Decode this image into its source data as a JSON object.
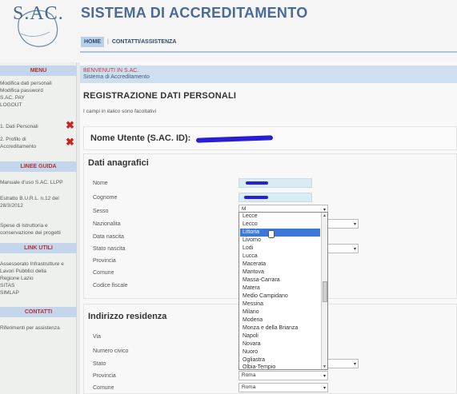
{
  "header": {
    "logo_text": "S.AC.",
    "title": "SISTEMA DI ACCREDITAMENTO",
    "nav": {
      "home": "HOME",
      "separator": "|",
      "contact": "CONTATTI/ASSISTENZA"
    }
  },
  "sidebar": {
    "menu_head": "MENU",
    "menu_items": [
      "Modifica dati personali",
      "Modifica password",
      "S.AC. PAY",
      "LOGOUT"
    ],
    "steps": [
      "1. Dati Personali",
      "2. Profilo di",
      "Accreditamento"
    ],
    "guide_head": "LINEE GUIDA",
    "guide_items": [
      "Manuale d'uso S.AC. LLPP",
      "Estratto B.U.R.L. n.12 del",
      "28/3/2012",
      "Spese di Istruttoria e",
      "conservazione dei progetti"
    ],
    "links_head": "LINK UTILI",
    "links_items": [
      "Assessorato Infrastrutture e",
      "Lavori Pubblici della",
      "Regione Lazio",
      "SITAS",
      "SIMLAP"
    ],
    "contacts_head": "CONTATTI",
    "contacts_items": [
      "Riferimenti per assistenza"
    ]
  },
  "main": {
    "welcome": "BENVENUTI IN S.AC.",
    "welcome_sub": "Sistema di Accreditamento",
    "page_title": "REGISTRAZIONE DATI PERSONALI",
    "hint_prefix": "I campi in",
    "hint_italic": "italico",
    "hint_suffix": "sono facoltativi",
    "user_label": "Nome Utente (S.AC. ID):",
    "section_personal": "Dati anagrafici",
    "labels_personal": [
      "Nome",
      "Cognome",
      "Sesso",
      "Nazionalita",
      "Data nascita",
      "Stato nascita",
      "Provincia",
      "Comune",
      "Codice fiscale"
    ],
    "sesso_value": "M",
    "section_address": "Indirizzo residenza",
    "labels_address": [
      "Via",
      "Numero civico",
      "Stato",
      "Provincia",
      "Comune"
    ],
    "provincia_value": "Roma",
    "comune_value": "Roma"
  },
  "dropdown": {
    "options": [
      "Lecce",
      "Lecco",
      "Littoria",
      "Livorno",
      "Lodi",
      "Lucca",
      "Macerata",
      "Mantova",
      "Massa-Carrara",
      "Matera",
      "Medio Campidano",
      "Messina",
      "Milano",
      "Modena",
      "Monza e della Brianza",
      "Napoli",
      "Novara",
      "Nuoro",
      "Ogliastra",
      "Olbia-Tempio"
    ],
    "selected": "Littoria"
  },
  "colors": {
    "accent": "#4a6a98",
    "nav_bg": "#c3d6ec",
    "error_red": "#d12020",
    "selection": "#3b78d8"
  }
}
